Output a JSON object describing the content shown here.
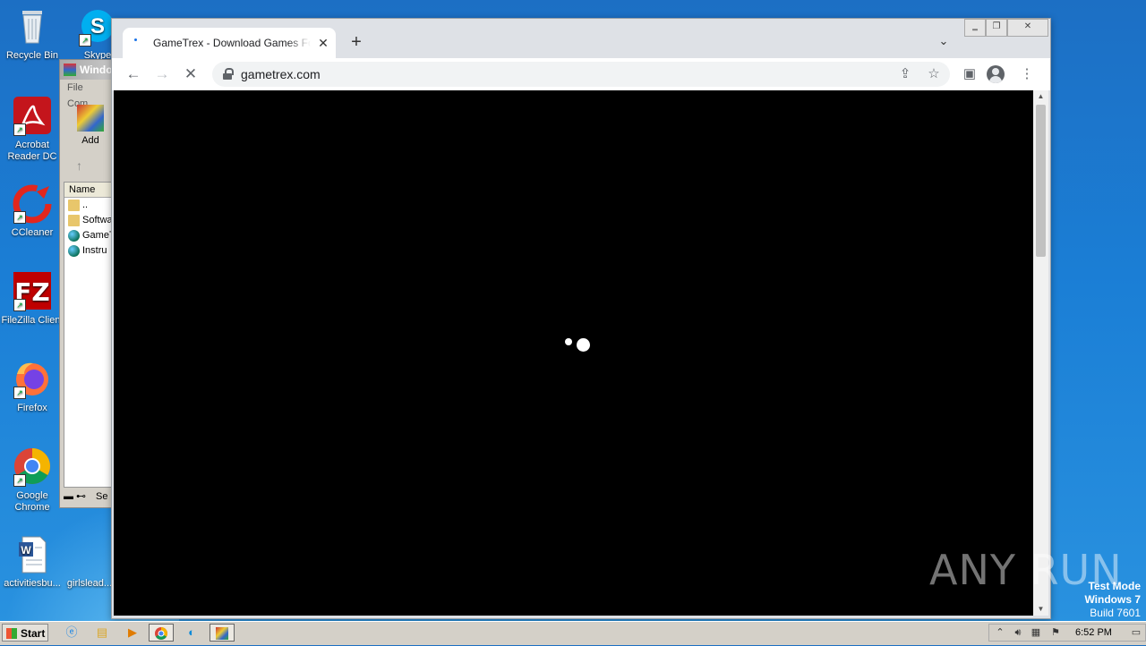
{
  "desktop": {
    "icons": [
      {
        "name": "recycle-bin",
        "label": "Recycle Bin"
      },
      {
        "name": "skype",
        "label": "Skype"
      },
      {
        "name": "acrobat-reader",
        "label": "Acrobat Reader DC"
      },
      {
        "name": "ccleaner",
        "label": "CCleaner"
      },
      {
        "name": "filezilla",
        "label": "FileZilla Client"
      },
      {
        "name": "firefox",
        "label": "Firefox"
      },
      {
        "name": "google-chrome",
        "label": "Google Chrome"
      },
      {
        "name": "activitiesbu",
        "label": "activitiesbu..."
      },
      {
        "name": "girlslead",
        "label": "girlslead..."
      }
    ]
  },
  "winrar": {
    "title": "Windo",
    "menu": [
      "File",
      "Com"
    ],
    "toolbar_add": "Add",
    "list_header": "Name",
    "rows": [
      "..",
      "Softwa",
      "GameT",
      "Instru"
    ],
    "status": "Se"
  },
  "chrome": {
    "tab_title": "GameTrex - Download Games For Free",
    "url": "gametrex.com",
    "accent": "#1a73e8"
  },
  "watermark": {
    "text": "ANY RUN"
  },
  "os_info": {
    "mode": "Test Mode",
    "os": "Windows 7",
    "build": "Build 7601"
  },
  "taskbar": {
    "start_label": "Start",
    "clock": "6:52 PM"
  }
}
